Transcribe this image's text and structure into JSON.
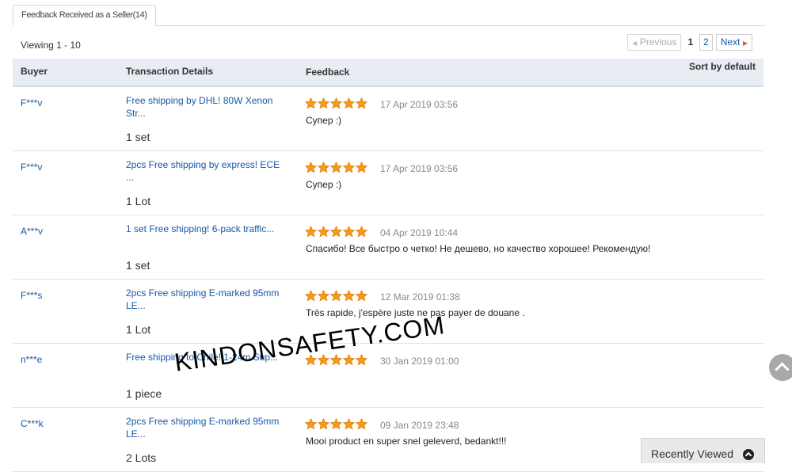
{
  "tab": {
    "label": "Feedback Received as a Seller(14)"
  },
  "viewing": "Viewing 1 - 10",
  "pager": {
    "previous": "Previous",
    "pages": [
      "1",
      "2"
    ],
    "next": "Next"
  },
  "columns": {
    "buyer": "Buyer",
    "transaction": "Transaction Details",
    "feedback": "Feedback",
    "sort": "Sort by default"
  },
  "rows": [
    {
      "buyer": "F***v",
      "transaction": "Free shipping by DHL! 80W Xenon Str...",
      "qty": "1 set",
      "stars": 5,
      "date": "17 Apr 2019 03:56",
      "comment": "Супер :)"
    },
    {
      "buyer": "F***v",
      "transaction": "2pcs Free shipping by express! ECE ...",
      "qty": "1 Lot",
      "stars": 5,
      "date": "17 Apr 2019 03:56",
      "comment": "Супер :)"
    },
    {
      "buyer": "A***v",
      "transaction": "1 set Free shipping! 6-pack traffic...",
      "qty": "1 set",
      "stars": 5,
      "date": "04 Apr 2019 10:44",
      "comment": "Спасибо! Все быстро о четко! Не дешево, но качество хорошее! Рекомендую!"
    },
    {
      "buyer": "F***s",
      "transaction": "2pcs Free shipping E-marked 95mm LE...",
      "qty": "1 Lot",
      "stars": 5,
      "date": "12 Mar 2019 01:38",
      "comment": "Très rapide, j'espère juste ne pas payer de douane ."
    },
    {
      "buyer": "n***e",
      "transaction": "Free shipping to Chile! 1-24m Sup...",
      "qty": "1 piece",
      "stars": 5,
      "date": "30 Jan 2019 01:00",
      "comment": ""
    },
    {
      "buyer": "C***k",
      "transaction": "2pcs Free shipping E-marked 95mm LE...",
      "qty": "2 Lots",
      "stars": 5,
      "date": "09 Jan 2019 23:48",
      "comment": "Mooi product en super snel geleverd, bedankt!!!"
    }
  ],
  "watermark": "KINDONSAFETY.COM",
  "recently_viewed": "Recently Viewed",
  "colors": {
    "link": "#1659a8",
    "star": "#f39a1a",
    "header_bg": "#e8ecf3"
  }
}
